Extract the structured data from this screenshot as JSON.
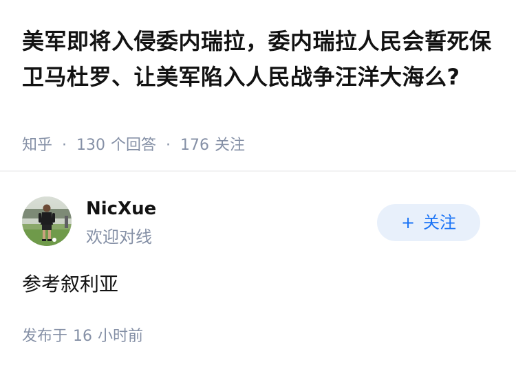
{
  "question": {
    "title": "美军即将入侵委内瑞拉，委内瑞拉人民会誓死保卫马杜罗、让美军陷入人民战争汪洋大海么?",
    "source": "知乎",
    "separator": "·",
    "answer_count": "130",
    "answer_unit": "个回答",
    "follow_count": "176",
    "follow_unit": "关注"
  },
  "answer": {
    "author": {
      "name": "NicXue",
      "bio": "欢迎对线",
      "avatar_icon": "avatar-photo-soccer-player"
    },
    "follow_button": {
      "plus": "+",
      "label": "关注"
    },
    "content": "参考叙利亚",
    "publish_prefix": "发布于",
    "publish_count": "16",
    "publish_unit": "小时前"
  },
  "colors": {
    "text": "#121212",
    "muted": "#8590a6",
    "accent": "#1772f6",
    "button_bg": "#e8f0fb",
    "divider": "#f2f2f3"
  }
}
